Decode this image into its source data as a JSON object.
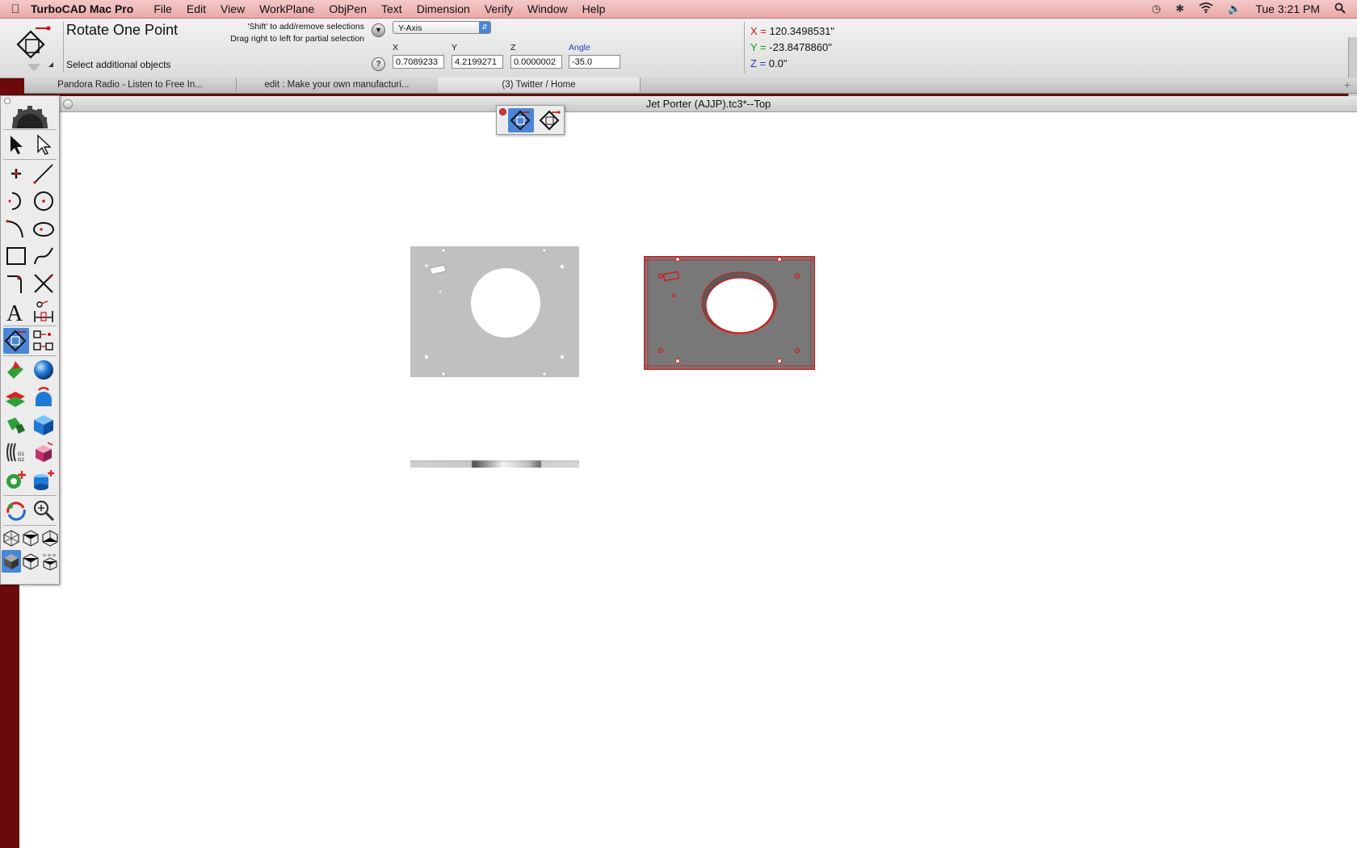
{
  "menubar": {
    "app_name": "TurboCAD Mac Pro",
    "items": [
      "File",
      "Edit",
      "View",
      "WorkPlane",
      "ObjPen",
      "Text",
      "Dimension",
      "Verify",
      "Window",
      "Help"
    ],
    "clock": "Tue 3:21 PM"
  },
  "tool": {
    "title": "Rotate One Point",
    "prompt": "Select additional objects",
    "hint_line1": "'Shift' to add/remove selections",
    "hint_line2": "Drag right to left for partial selection",
    "axis_select": "Y-Axis",
    "fields": {
      "x_label": "X",
      "x_value": "0.7089233",
      "y_label": "Y",
      "y_value": "4.2199271",
      "z_label": "Z",
      "z_value": "0.0000002",
      "angle_label": "Angle",
      "angle_value": "-35.0"
    }
  },
  "coords": {
    "x_key": "X =",
    "x": "120.3498531\"",
    "y_key": "Y =",
    "y": "-23.8478860\"",
    "z_key": "Z =",
    "z": "0.0\""
  },
  "tabs": [
    {
      "label": "Pandora Radio - Listen to Free In..."
    },
    {
      "label": "edit : Make your own manufacturi..."
    },
    {
      "label": "(3) Twitter / Home"
    }
  ],
  "document": {
    "title": "Jet Porter (AJJP).tc3*--Top"
  },
  "colors": {
    "menubar": "#eeb3b3",
    "selection_blue": "#4a86d8",
    "selected_outline": "#e01010",
    "x_axis": "#d01010",
    "y_axis": "#10a010",
    "z_axis": "#3030d0"
  }
}
